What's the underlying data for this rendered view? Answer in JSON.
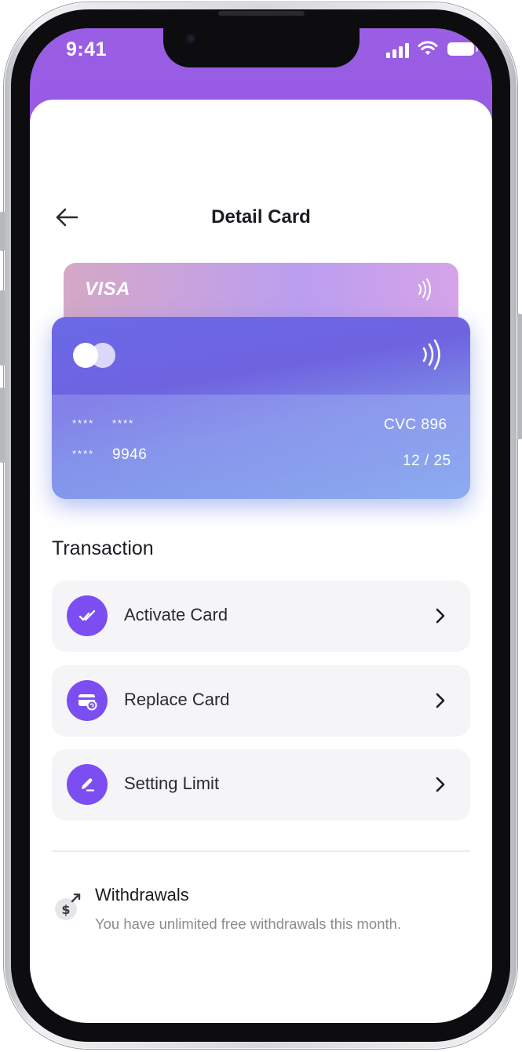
{
  "status_bar": {
    "time": "9:41"
  },
  "header": {
    "title": "Detail Card"
  },
  "card_back": {
    "brand": "VISA"
  },
  "card_front": {
    "number_row1_a": "****",
    "number_row1_b": "****",
    "number_row2_a": "****",
    "number_row2_b": "9946",
    "cvc": "CVC 896",
    "expiry": "12 / 25"
  },
  "transaction": {
    "title": "Transaction",
    "items": [
      {
        "label": "Activate Card",
        "icon": "double-check-icon"
      },
      {
        "label": "Replace Card",
        "icon": "card-refresh-icon"
      },
      {
        "label": "Setting Limit",
        "icon": "pencil-icon"
      }
    ]
  },
  "withdrawals": {
    "title": "Withdrawals",
    "subtitle": "You have unlimited free withdrawals this month.",
    "icon": "dollar-withdraw-icon"
  },
  "colors": {
    "accent": "#7c4ef2",
    "header_gradient_start": "#9a5ee4",
    "header_gradient_end": "#7a48ea",
    "row_background": "#f5f5f8"
  }
}
